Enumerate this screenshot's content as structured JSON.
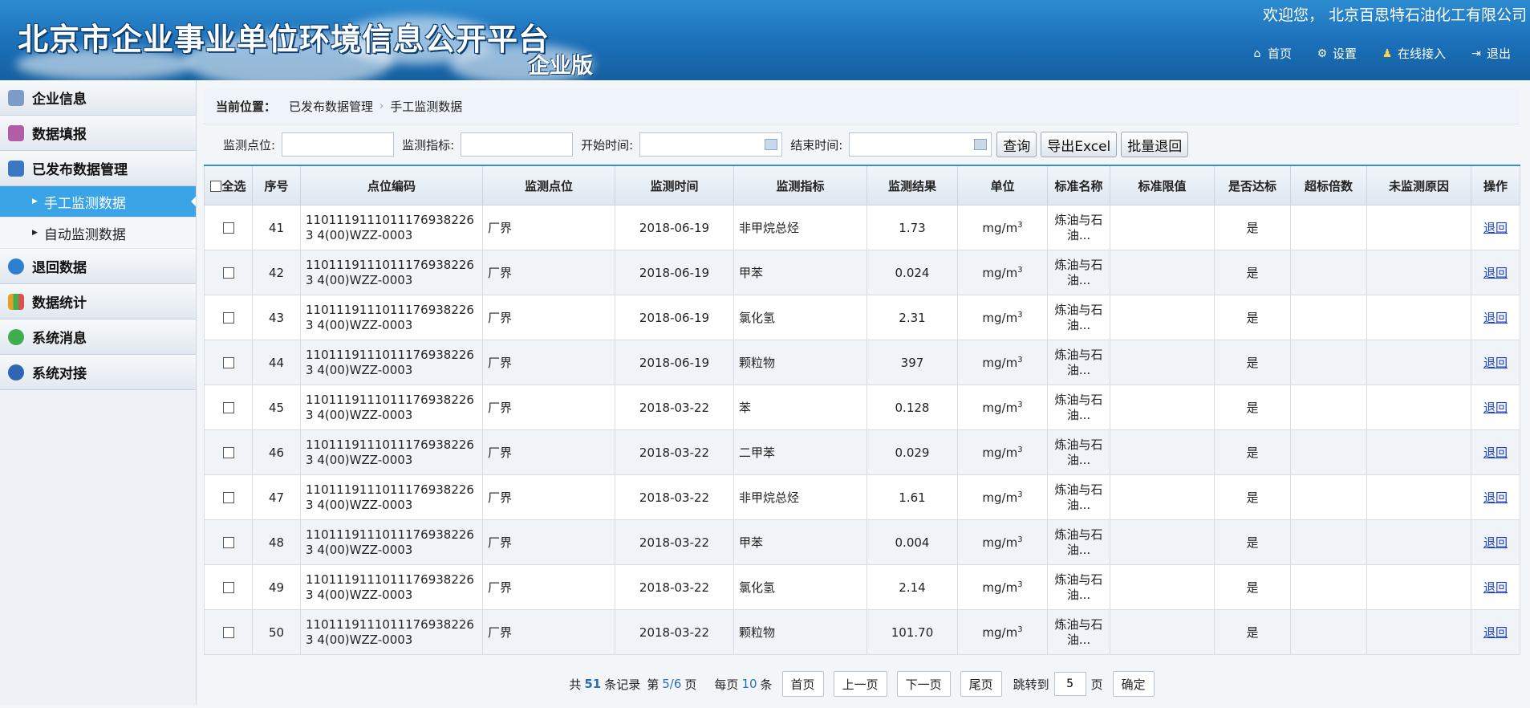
{
  "header": {
    "title": "北京市企业事业单位环境信息公开平台",
    "edition": "企业版",
    "welcome": "欢迎您，  北京百思特石油化工有限公司",
    "nav": [
      {
        "label": "首页",
        "icon": "home-icon"
      },
      {
        "label": "设置",
        "icon": "gear-icon"
      },
      {
        "label": "在线接入",
        "icon": "people-icon"
      },
      {
        "label": "退出",
        "icon": "logout-icon"
      }
    ]
  },
  "sidebar": {
    "items": [
      {
        "label": "企业信息",
        "color": "#5b7fb5"
      },
      {
        "label": "数据填报",
        "color": "#b35da8"
      },
      {
        "label": "已发布数据管理",
        "color": "#3b78c4"
      },
      {
        "label": "退回数据",
        "color": "#2d7fd0"
      },
      {
        "label": "数据统计",
        "color": "#e4a12a"
      },
      {
        "label": "系统消息",
        "color": "#3fae4f"
      },
      {
        "label": "系统对接",
        "color": "#2f65b5"
      }
    ],
    "subitems": [
      "手工监测数据",
      "自动监测数据"
    ]
  },
  "breadcrumb": {
    "label": "当前位置：",
    "parent": "已发布数据管理",
    "current": "手工监测数据"
  },
  "filters": {
    "point_label": "监测点位:",
    "indicator_label": "监测指标:",
    "start_label": "开始时间:",
    "end_label": "结束时间:",
    "point_value": "",
    "indicator_value": "",
    "start_value": "",
    "end_value": "",
    "query_btn": "查询",
    "export_btn": "导出Excel",
    "batch_btn": "批量退回"
  },
  "table": {
    "headers": [
      "全选",
      "序号",
      "点位编码",
      "监测点位",
      "监测时间",
      "监测指标",
      "监测结果",
      "单位",
      "标准名称",
      "标准限值",
      "是否达标",
      "超标倍数",
      "未监测原因",
      "操作"
    ],
    "unit_base": "mg/m",
    "unit_sup": "3",
    "action": "退回",
    "rows": [
      {
        "no": "41",
        "code": "11011191110111769382263 4(00)WZZ-0003",
        "point": "厂界",
        "time": "2018-06-19",
        "indicator": "非甲烷总烃",
        "result": "1.73",
        "std_name": "炼油与石油...",
        "limit": "",
        "ok": "是",
        "over": "",
        "reason": ""
      },
      {
        "no": "42",
        "code": "11011191110111769382263 4(00)WZZ-0003",
        "point": "厂界",
        "time": "2018-06-19",
        "indicator": "甲苯",
        "result": "0.024",
        "std_name": "炼油与石油...",
        "limit": "",
        "ok": "是",
        "over": "",
        "reason": ""
      },
      {
        "no": "43",
        "code": "11011191110111769382263 4(00)WZZ-0003",
        "point": "厂界",
        "time": "2018-06-19",
        "indicator": "氯化氢",
        "result": "2.31",
        "std_name": "炼油与石油...",
        "limit": "",
        "ok": "是",
        "over": "",
        "reason": ""
      },
      {
        "no": "44",
        "code": "11011191110111769382263 4(00)WZZ-0003",
        "point": "厂界",
        "time": "2018-06-19",
        "indicator": "颗粒物",
        "result": "397",
        "std_name": "炼油与石油...",
        "limit": "",
        "ok": "是",
        "over": "",
        "reason": ""
      },
      {
        "no": "45",
        "code": "11011191110111769382263 4(00)WZZ-0003",
        "point": "厂界",
        "time": "2018-03-22",
        "indicator": "苯",
        "result": "0.128",
        "std_name": "炼油与石油...",
        "limit": "",
        "ok": "是",
        "over": "",
        "reason": ""
      },
      {
        "no": "46",
        "code": "11011191110111769382263 4(00)WZZ-0003",
        "point": "厂界",
        "time": "2018-03-22",
        "indicator": "二甲苯",
        "result": "0.029",
        "std_name": "炼油与石油...",
        "limit": "",
        "ok": "是",
        "over": "",
        "reason": ""
      },
      {
        "no": "47",
        "code": "11011191110111769382263 4(00)WZZ-0003",
        "point": "厂界",
        "time": "2018-03-22",
        "indicator": "非甲烷总烃",
        "result": "1.61",
        "std_name": "炼油与石油...",
        "limit": "",
        "ok": "是",
        "over": "",
        "reason": ""
      },
      {
        "no": "48",
        "code": "11011191110111769382263 4(00)WZZ-0003",
        "point": "厂界",
        "time": "2018-03-22",
        "indicator": "甲苯",
        "result": "0.004",
        "std_name": "炼油与石油...",
        "limit": "",
        "ok": "是",
        "over": "",
        "reason": ""
      },
      {
        "no": "49",
        "code": "11011191110111769382263 4(00)WZZ-0003",
        "point": "厂界",
        "time": "2018-03-22",
        "indicator": "氯化氢",
        "result": "2.14",
        "std_name": "炼油与石油...",
        "limit": "",
        "ok": "是",
        "over": "",
        "reason": ""
      },
      {
        "no": "50",
        "code": "11011191110111769382263 4(00)WZZ-0003",
        "point": "厂界",
        "time": "2018-03-22",
        "indicator": "颗粒物",
        "result": "101.70",
        "std_name": "炼油与石油...",
        "limit": "",
        "ok": "是",
        "over": "",
        "reason": ""
      }
    ]
  },
  "pager": {
    "total_prefix": "共",
    "total": "51",
    "total_suffix": "条记录",
    "page_prefix": "第",
    "page": "5/6",
    "page_suffix": "页",
    "per_prefix": "每页",
    "per": "10",
    "per_suffix": "条",
    "first": "首页",
    "prev": "上一页",
    "next": "下一页",
    "last": "尾页",
    "jump_label": "跳转到",
    "jump_value": "5",
    "jump_suffix": "页",
    "confirm": "确定"
  }
}
